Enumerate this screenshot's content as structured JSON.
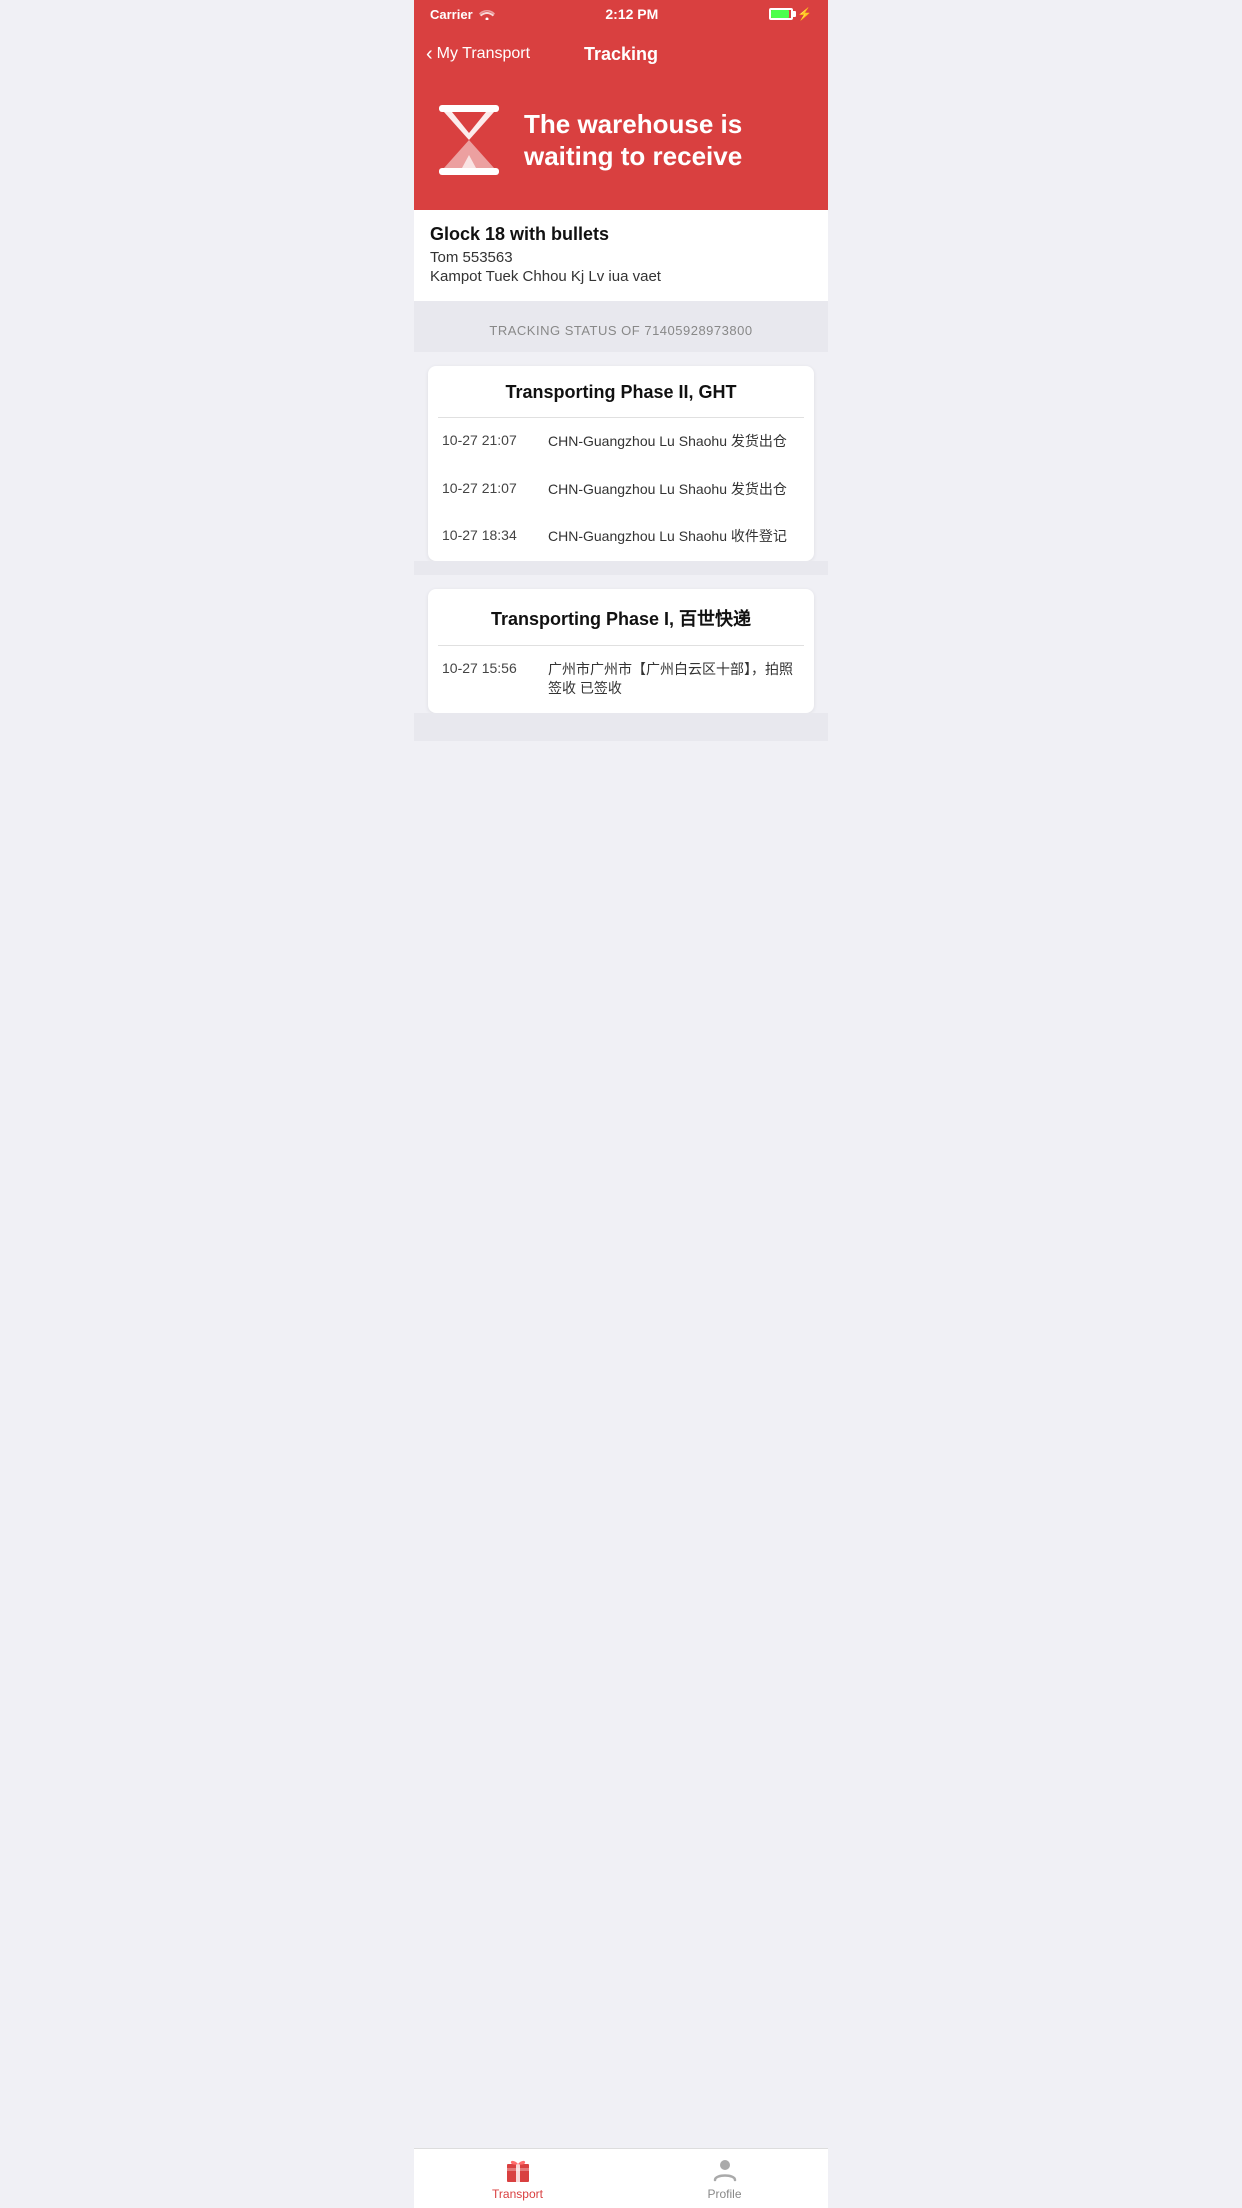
{
  "statusBar": {
    "carrier": "Carrier",
    "time": "2:12 PM"
  },
  "navBar": {
    "backLabel": "My Transport",
    "title": "Tracking"
  },
  "heroBanner": {
    "statusText": "The warehouse is waiting to receive"
  },
  "packageInfo": {
    "name": "Glock 18 with bullets",
    "contact": "Tom 553563",
    "address": "Kampot Tuek Chhou Kj Lv iua vaet"
  },
  "trackingHeader": {
    "label": "TRACKING STATUS OF 71405928973800"
  },
  "trackingCards": [
    {
      "title": "Transporting Phase II, GHT",
      "rows": [
        {
          "time": "10-27 21:07",
          "desc": "CHN-Guangzhou Lu Shaohu 发货出仓"
        },
        {
          "time": "10-27 21:07",
          "desc": "CHN-Guangzhou Lu Shaohu 发货出仓"
        },
        {
          "time": "10-27 18:34",
          "desc": "CHN-Guangzhou Lu Shaohu 收件登记"
        }
      ]
    },
    {
      "title": "Transporting Phase I, 百世快递",
      "rows": [
        {
          "time": "10-27 15:56",
          "desc": "广州市广州市【广州白云区十部】，拍照签收 已签收"
        }
      ]
    }
  ],
  "tabBar": {
    "tabs": [
      {
        "id": "transport",
        "label": "Transport",
        "active": true
      },
      {
        "id": "profile",
        "label": "Profile",
        "active": false
      }
    ]
  }
}
